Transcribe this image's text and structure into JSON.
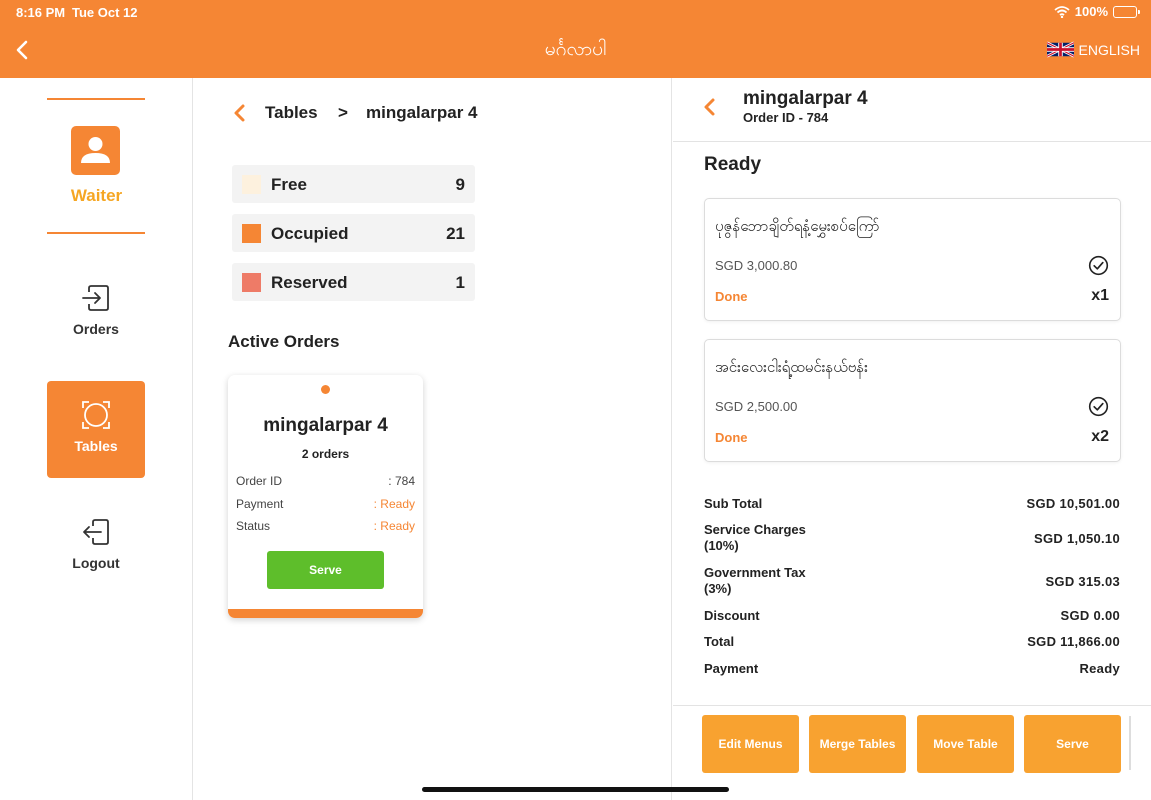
{
  "status_bar": {
    "time": "8:16 PM",
    "date": "Tue Oct 12",
    "battery": "100%"
  },
  "header": {
    "title": "မင်္ဂလာပါ",
    "language": "ENGLISH"
  },
  "sidebar": {
    "user_label": "Waiter",
    "items": [
      {
        "label": "Orders",
        "icon": "orders-icon"
      },
      {
        "label": "Tables",
        "icon": "tables-icon"
      },
      {
        "label": "Logout",
        "icon": "logout-icon"
      }
    ]
  },
  "breadcrumb": {
    "root": "Tables",
    "separator": ">",
    "current": "mingalarpar 4"
  },
  "legend": [
    {
      "label": "Free",
      "count": "9",
      "color": "#FDF1DE"
    },
    {
      "label": "Occupied",
      "count": "21",
      "color": "#F58634"
    },
    {
      "label": "Reserved",
      "count": "1",
      "color": "#EE7B67"
    }
  ],
  "active_orders": {
    "title": "Active Orders",
    "card": {
      "table_name": "mingalarpar 4",
      "orders_count": "2 orders",
      "rows": [
        {
          "label": "Order ID",
          "value": ": 784"
        },
        {
          "label": "Payment",
          "value": ": Ready"
        },
        {
          "label": "Status",
          "value": ": Ready"
        }
      ],
      "serve_label": "Serve"
    }
  },
  "order_detail": {
    "table_name": "mingalarpar 4",
    "order_id": "Order ID - 784",
    "status": "Ready",
    "items": [
      {
        "name": "ပုဇွန်ဘောချိတ်ရနံ့မွှေးစပ်ကြော်",
        "price": "SGD 3,000.80",
        "status": "Done",
        "qty": "x1"
      },
      {
        "name": "အင်းလေးငါးရံ့ထမင်းနယ်ဗန်း",
        "price": "SGD 2,500.00",
        "status": "Done",
        "qty": "x2"
      }
    ],
    "summary": [
      {
        "label": "Sub Total",
        "value": "SGD 10,501.00"
      },
      {
        "label": "Service Charges (10%)",
        "value": "SGD 1,050.10"
      },
      {
        "label": "Government Tax (3%)",
        "value": "SGD 315.03"
      },
      {
        "label": "Discount",
        "value": "SGD 0.00"
      },
      {
        "label": "Total",
        "value": "SGD 11,866.00"
      },
      {
        "label": "Payment",
        "value": "Ready"
      }
    ],
    "actions": [
      "Edit Menus",
      "Merge Tables",
      "Move Table",
      "Serve"
    ]
  },
  "colors": {
    "primary": "#F58634",
    "button": "#F8A230",
    "serve_green": "#5EBE2B",
    "waiter_label": "#F5A623"
  }
}
